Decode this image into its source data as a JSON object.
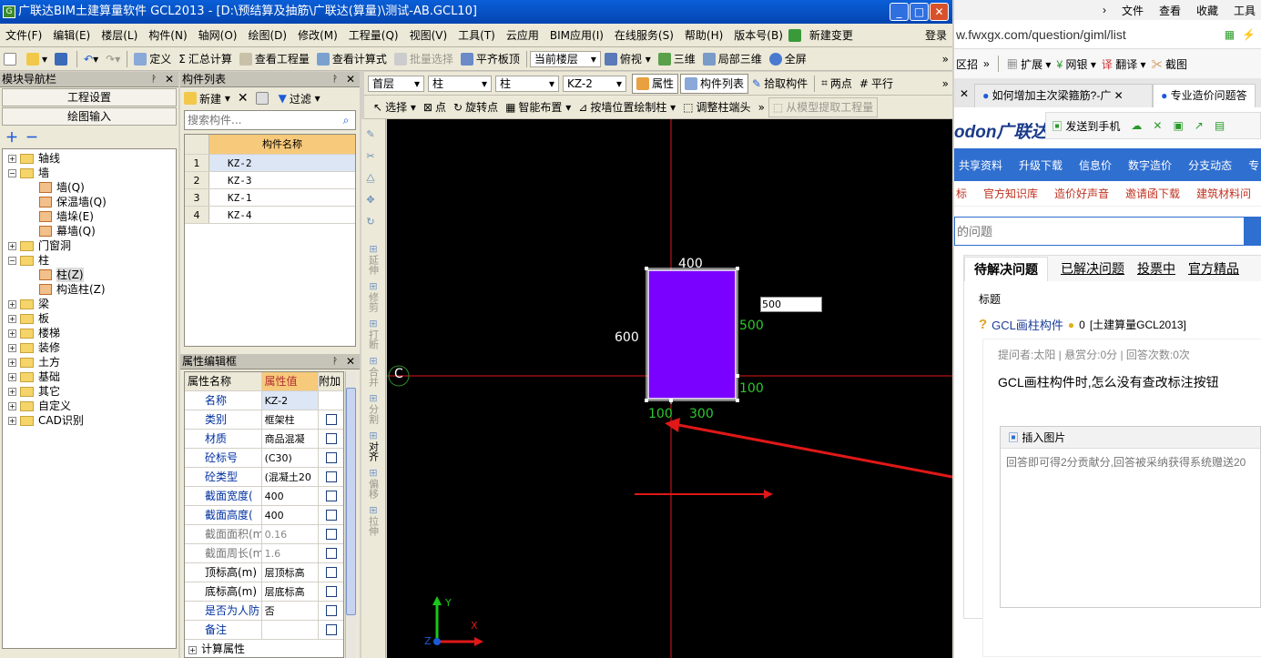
{
  "app": {
    "title": "广联达BIM土建算量软件 GCL2013 - [D:\\预结算及抽筋\\广联达(算量)\\测试-AB.GCL10]",
    "icon": "glodon-app-icon"
  },
  "menu": {
    "items": [
      "文件(F)",
      "编辑(E)",
      "楼层(L)",
      "构件(N)",
      "轴网(O)",
      "绘图(D)",
      "修改(M)",
      "工程量(Q)",
      "视图(V)",
      "工具(T)",
      "云应用",
      "BIM应用(I)",
      "在线服务(S)",
      "帮助(H)",
      "版本号(B)",
      "新建变更"
    ],
    "login": "登录"
  },
  "toolbar1": {
    "define": "定义",
    "sum": "汇总计算",
    "view_qty": "查看工程量",
    "view_formula": "查看计算式",
    "batch_select": "批量选择",
    "flat_top": "平齐板顶",
    "floor_mode": "当前楼层",
    "view_mode": "俯视",
    "three_d": "三维",
    "local_3d": "局部三维",
    "fullscreen": "全屏"
  },
  "toolbar2": {
    "floor": "首层",
    "type1": "柱",
    "type2": "柱",
    "component": "KZ-2",
    "properties": "属性",
    "component_list": "构件列表",
    "pick": "拾取构件",
    "two_points": "两点",
    "parallel": "平行"
  },
  "toolbar3": {
    "select": "选择",
    "point": "点",
    "rotate_point": "旋转点",
    "smart_layout": "智能布置",
    "draw_by_wall": "按墙位置绘制柱",
    "adjust_end": "调整柱端头",
    "extract": "从模型提取工程量"
  },
  "nav": {
    "title": "模块导航栏",
    "project_settings": "工程设置",
    "drawing_input": "绘图输入",
    "tree": [
      {
        "label": "轴线",
        "level": 0,
        "exp": "+"
      },
      {
        "label": "墙",
        "level": 0,
        "exp": "-"
      },
      {
        "label": "墙(Q)",
        "level": 1
      },
      {
        "label": "保温墙(Q)",
        "level": 1
      },
      {
        "label": "墙垛(E)",
        "level": 1
      },
      {
        "label": "幕墙(Q)",
        "level": 1
      },
      {
        "label": "门窗洞",
        "level": 0,
        "exp": "+"
      },
      {
        "label": "柱",
        "level": 0,
        "exp": "-"
      },
      {
        "label": "柱(Z)",
        "level": 1
      },
      {
        "label": "构造柱(Z)",
        "level": 1
      },
      {
        "label": "梁",
        "level": 0,
        "exp": "+"
      },
      {
        "label": "板",
        "level": 0,
        "exp": "+"
      },
      {
        "label": "楼梯",
        "level": 0,
        "exp": "+"
      },
      {
        "label": "装修",
        "level": 0,
        "exp": "+"
      },
      {
        "label": "土方",
        "level": 0,
        "exp": "+"
      },
      {
        "label": "基础",
        "level": 0,
        "exp": "+"
      },
      {
        "label": "其它",
        "level": 0,
        "exp": "+"
      },
      {
        "label": "自定义",
        "level": 0,
        "exp": "+"
      },
      {
        "label": "CAD识别",
        "level": 0,
        "exp": "+"
      }
    ]
  },
  "complist": {
    "title": "构件列表",
    "new": "新建",
    "filter": "过滤",
    "search_placeholder": "搜索构件...",
    "col": "构件名称",
    "rows": [
      {
        "n": "1",
        "v": "KZ-2"
      },
      {
        "n": "2",
        "v": "KZ-3"
      },
      {
        "n": "3",
        "v": "KZ-1"
      },
      {
        "n": "4",
        "v": "KZ-4"
      }
    ]
  },
  "props": {
    "title": "属性编辑框",
    "col_name": "属性名称",
    "col_value": "属性值",
    "col_extra": "附加",
    "rows": [
      {
        "k": "名称",
        "v": "KZ-2",
        "cb": false,
        "t": "n"
      },
      {
        "k": "类别",
        "v": "框架柱",
        "cb": true,
        "t": "n"
      },
      {
        "k": "材质",
        "v": "商品混凝",
        "cb": true,
        "t": "n"
      },
      {
        "k": "砼标号",
        "v": "(C30)",
        "cb": true,
        "t": "n"
      },
      {
        "k": "砼类型",
        "v": "(混凝土20",
        "cb": true,
        "t": "n"
      },
      {
        "k": "截面宽度(",
        "v": "400",
        "cb": true,
        "t": "n"
      },
      {
        "k": "截面高度(",
        "v": "400",
        "cb": true,
        "t": "n"
      },
      {
        "k": "截面面积(m",
        "v": "0.16",
        "cb": true,
        "t": "g"
      },
      {
        "k": "截面周长(m",
        "v": "1.6",
        "cb": true,
        "t": "g"
      },
      {
        "k": "顶标高(m)",
        "v": "层顶标高",
        "cb": true,
        "t": "b"
      },
      {
        "k": "底标高(m)",
        "v": "层底标高",
        "cb": true,
        "t": "b"
      },
      {
        "k": "是否为人防",
        "v": "否",
        "cb": true,
        "t": "n"
      },
      {
        "k": "备注",
        "v": "",
        "cb": true,
        "t": "n"
      }
    ],
    "calc": "计算属性"
  },
  "sidetools": [
    "延伸",
    "修剪",
    "打断",
    "合并",
    "分割",
    "对齐",
    "偏移",
    "拉伸"
  ],
  "canvas": {
    "axis_label": "C",
    "dim_top": "400",
    "dim_left": "600",
    "dim_right": "500",
    "dim_rb": "100",
    "dim_bl": "100",
    "dim_br": "300",
    "input_value": "500",
    "axis_y": "Y",
    "axis_x": "X",
    "axis_z": "Z",
    "column_color": "#7a00ff",
    "axis_color": "#e01818"
  },
  "browser": {
    "menu": [
      "文件",
      "查看",
      "收藏",
      "工具"
    ],
    "url": "w.fwxgx.com/question/giml/list",
    "fav": [
      "区招",
      "扩展",
      "网银",
      "翻译",
      "截图"
    ],
    "tabs": [
      "如何增加主次梁箍筋?-广",
      "专业造价问题答"
    ],
    "send_phone": "发送到手机",
    "logo": "odon广联达",
    "nav1": [
      "共享资料",
      "升级下载",
      "信息价",
      "数字造价",
      "分支动态",
      "专"
    ],
    "nav2": [
      "标",
      "官方知识库",
      "造价好声音",
      "邀请函下载",
      "建筑材料问"
    ],
    "search_placeholder": "的问题",
    "qtabs": [
      "待解决问题",
      "已解决问题",
      "投票中",
      "官方精品"
    ],
    "list_title": "标题",
    "q_title": "GCL画柱构件",
    "q_points": "0",
    "q_tag": "[土建算量GCL2013]",
    "meta": "提问者:太阳 | 悬赏分:0分 | 回答次数:0次",
    "asker": "太阳",
    "q_body": "GCL画柱构件时,怎么没有查改标注按钮",
    "insert_img": "插入图片",
    "answer_placeholder": "回答即可得2分贡献分,回答被采纳获得系统赠送20"
  }
}
